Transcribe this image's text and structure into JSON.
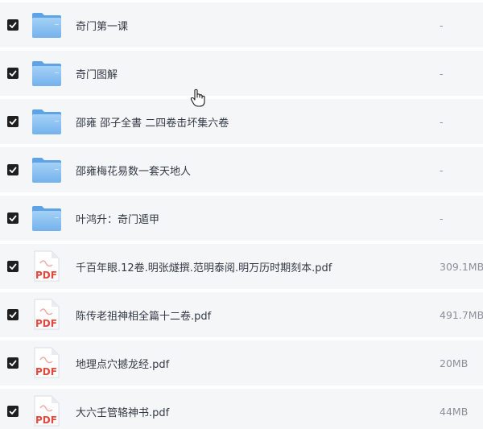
{
  "files": [
    {
      "name": "奇门第一课",
      "size": "-",
      "type": "folder",
      "checked": true
    },
    {
      "name": "奇门图解",
      "size": "-",
      "type": "folder",
      "checked": true
    },
    {
      "name": "邵雍 邵子全書 二四卷击坏集六卷",
      "size": "-",
      "type": "folder",
      "checked": true
    },
    {
      "name": "邵雍梅花易数一套天地人",
      "size": "-",
      "type": "folder",
      "checked": true
    },
    {
      "name": "叶鸿升：奇门遁甲",
      "size": "-",
      "type": "folder",
      "checked": true
    },
    {
      "name": "千百年眼.12卷.明张燧撰.范明泰阅.明万历时期刻本.pdf",
      "size": "309.1MB",
      "type": "pdf",
      "checked": true
    },
    {
      "name": "陈传老祖神相全篇十二卷.pdf",
      "size": "491.7MB",
      "type": "pdf",
      "checked": true
    },
    {
      "name": "地理点穴撼龙经.pdf",
      "size": "20MB",
      "type": "pdf",
      "checked": true
    },
    {
      "name": "大六壬管辂神书.pdf",
      "size": "44MB",
      "type": "pdf",
      "checked": true
    }
  ],
  "icons": {
    "folder": "folder-icon",
    "pdf": "pdf-file-icon",
    "pdf_label": "PDF",
    "checkbox": "checkbox-checked-icon",
    "cursor": "hand-pointer-cursor-icon"
  },
  "colors": {
    "row_background": "#f5f6f8",
    "folder_blue": "#7cb8ee",
    "pdf_red": "#e2483d",
    "checkbox": "#1f1f1f"
  }
}
